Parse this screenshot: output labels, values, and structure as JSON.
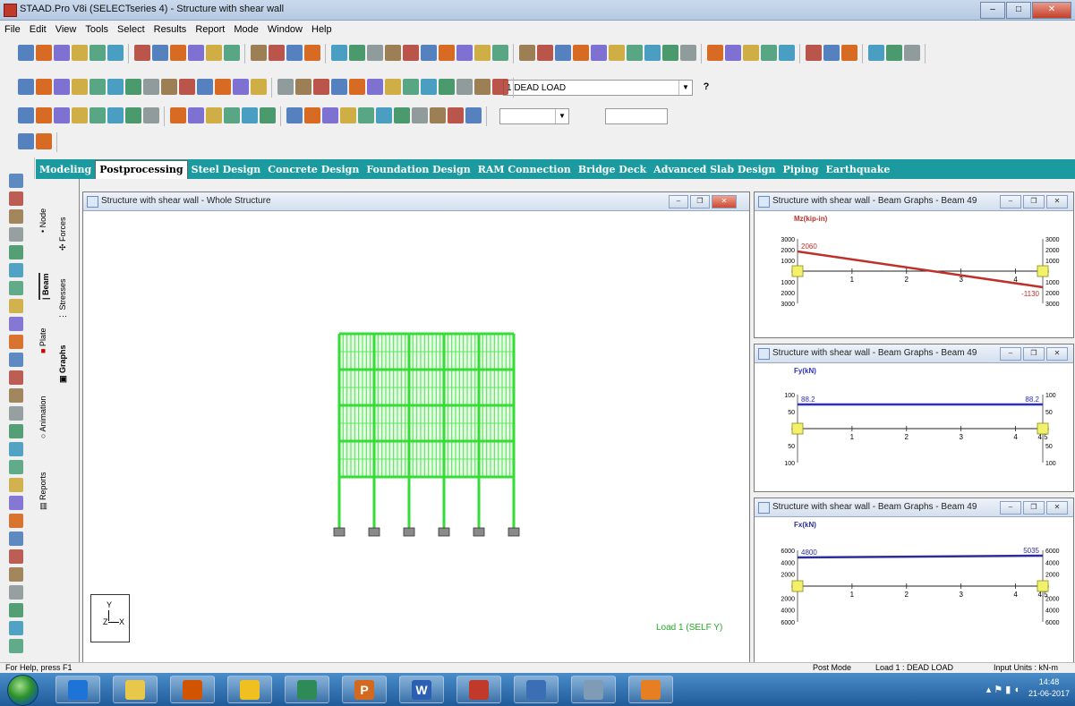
{
  "window": {
    "title": "STAAD.Pro V8i (SELECTseries 4) - Structure with shear wall",
    "controls": [
      "–",
      "□",
      "✕"
    ]
  },
  "menu": [
    "File",
    "Edit",
    "View",
    "Tools",
    "Select",
    "Results",
    "Report",
    "Mode",
    "Window",
    "Help"
  ],
  "toolbar": {
    "load_case_select": "1 DEAD LOAD",
    "help_glyph": "?"
  },
  "tabs": [
    {
      "label": "Modeling",
      "active": false
    },
    {
      "label": "Postprocessing",
      "active": true
    },
    {
      "label": "Steel Design",
      "active": false
    },
    {
      "label": "Concrete Design",
      "active": false
    },
    {
      "label": "Foundation Design",
      "active": false
    },
    {
      "label": "RAM Connection",
      "active": false
    },
    {
      "label": "Bridge Deck",
      "active": false
    },
    {
      "label": "Advanced Slab Design",
      "active": false
    },
    {
      "label": "Piping",
      "active": false
    },
    {
      "label": "Earthquake",
      "active": false
    }
  ],
  "page_control": {
    "tabs": [
      "Node",
      "Beam",
      "Plate",
      "Animation",
      "Reports"
    ],
    "sub_tabs": [
      "Forces",
      "Stresses",
      "Graphs"
    ]
  },
  "main_window": {
    "title": "Structure with shear wall - Whole Structure",
    "load_label": "Load 1 (SELF Y)",
    "axis_y": "Y",
    "axis_x": "X",
    "axis_z": "Z",
    "frame_color": "#33dd33",
    "wall_color": "#5fe85f"
  },
  "graphs": [
    {
      "title": "Structure with shear wall - Beam Graphs - Beam 49",
      "quantity": "Mz(kip-in)",
      "color": "#c0302a",
      "start_label": "2060",
      "end_label": "-1130",
      "y_ticks": [
        "3000",
        "2000",
        "1000",
        "0",
        "1000",
        "2000",
        "3000"
      ],
      "x_ticks": [
        "1",
        "2",
        "3",
        "4"
      ]
    },
    {
      "title": "Structure with shear wall - Beam Graphs - Beam 49",
      "quantity": "Fy(kN)",
      "color": "#2d2dc8",
      "start_label": "88.2",
      "end_label": "88.2",
      "y_ticks": [
        "100",
        "50",
        "0",
        "50",
        "100"
      ],
      "x_ticks": [
        "1",
        "2",
        "3",
        "4",
        "4.5"
      ]
    },
    {
      "title": "Structure with shear wall - Beam Graphs - Beam 49",
      "quantity": "Fx(kN)",
      "color": "#2d2d9a",
      "start_label": "4800",
      "end_label": "5035",
      "y_ticks": [
        "6000",
        "4000",
        "2000",
        "0",
        "2000",
        "4000",
        "6000"
      ],
      "x_ticks": [
        "1",
        "2",
        "3",
        "4",
        "4.5"
      ]
    }
  ],
  "status": {
    "help": "For Help, press F1",
    "mode": "Post Mode",
    "load": "Load 1 : DEAD LOAD",
    "units": "Input Units : kN-m"
  },
  "taskbar": {
    "time": "14:48",
    "date": "21-06-2017",
    "apps": [
      "ie-icon",
      "explorer-icon",
      "media-player-icon",
      "chrome-icon",
      "staad-icon",
      "powerpoint-icon",
      "word-icon",
      "acrobat-icon",
      "staad-pro-icon",
      "disk-icon",
      "vlc-icon"
    ],
    "app_letters": {
      "powerpoint": "P",
      "word": "W"
    }
  }
}
